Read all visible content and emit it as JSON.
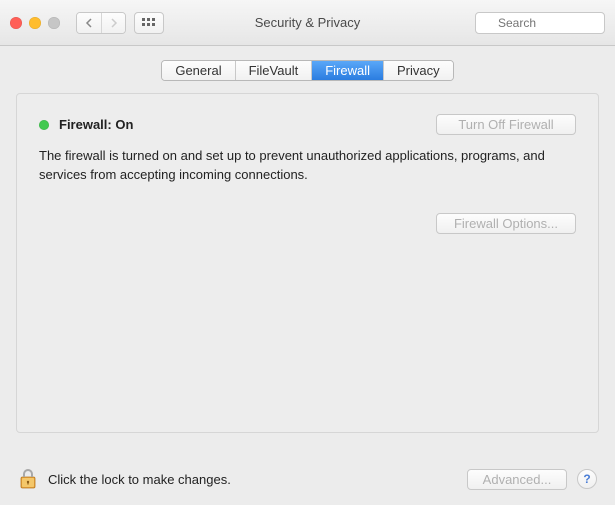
{
  "window": {
    "title": "Security & Privacy"
  },
  "search": {
    "placeholder": "Search"
  },
  "tabs": [
    {
      "label": "General"
    },
    {
      "label": "FileVault"
    },
    {
      "label": "Firewall",
      "active": true
    },
    {
      "label": "Privacy"
    }
  ],
  "firewall": {
    "status_label": "Firewall: On",
    "status_color": "#41c94f",
    "turn_off_label": "Turn Off Firewall",
    "description": "The firewall is turned on and set up to prevent unauthorized applications, programs, and services from accepting incoming connections.",
    "options_label": "Firewall Options..."
  },
  "footer": {
    "lock_text": "Click the lock to make changes.",
    "advanced_label": "Advanced...",
    "help_label": "?"
  }
}
